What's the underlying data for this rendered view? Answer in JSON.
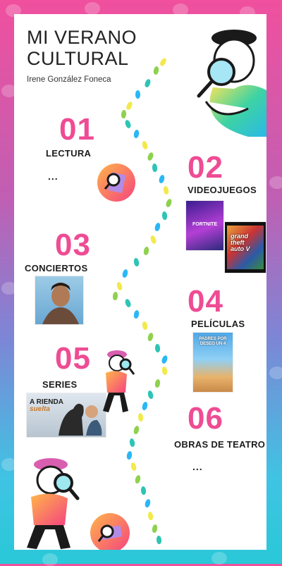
{
  "header": {
    "title_line1": "MI VERANO",
    "title_line2": "CULTURAL",
    "author": "Irene González Foneca"
  },
  "sections": [
    {
      "number": "01",
      "label": "LECTURA",
      "extra": "..."
    },
    {
      "number": "02",
      "label": "VIDEOJUEGOS",
      "images": [
        "fortnite-cover",
        "gta-v-cover"
      ]
    },
    {
      "number": "03",
      "label": "CONCIERTOS",
      "images": [
        "singer-portrait"
      ]
    },
    {
      "number": "04",
      "label": "PELÍCULAS",
      "images": [
        "movie-poster"
      ]
    },
    {
      "number": "05",
      "label": "SERIES",
      "images": [
        "a-rienda-suelta-poster"
      ]
    },
    {
      "number": "06",
      "label": "OBRAS DE TEATRO",
      "extra": "..."
    }
  ],
  "covers": {
    "fortnite": "FORTNITE",
    "gta_line1": "grand",
    "gta_line2": "theft",
    "gta_line3": "auto",
    "gta_num": "V",
    "movie_title": "PADRES POR DESEO UN 4",
    "series_title_1": "A RIENDA",
    "series_title_2": "suelta"
  },
  "colors": {
    "accent": "#ee4c94",
    "step_colors": [
      "#f2e94e",
      "#8fd14f",
      "#2ec4b6",
      "#2ab7f6"
    ],
    "bg_top": "#f0509e",
    "bg_bottom": "#29c8d8"
  }
}
